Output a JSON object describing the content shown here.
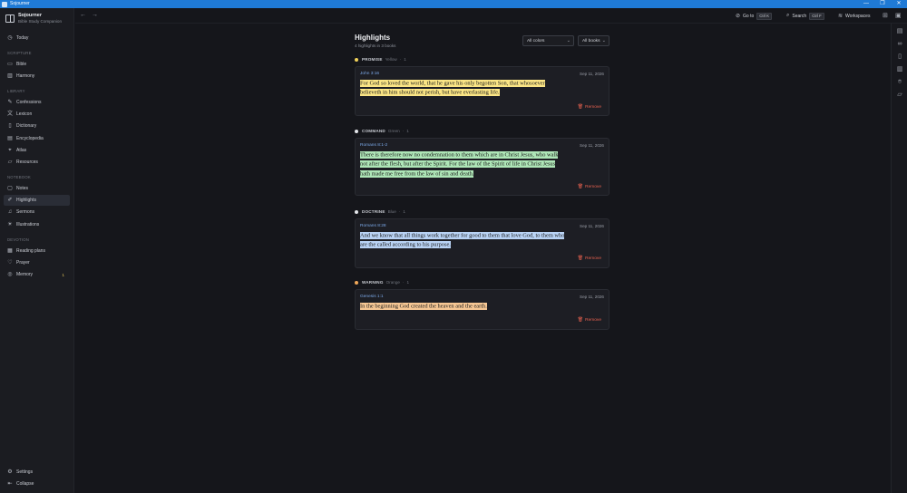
{
  "window": {
    "title": "Sojourner",
    "controls": [
      "—",
      "❐",
      "✕"
    ]
  },
  "brand": {
    "name": "Sojourner",
    "subtitle": "Bible Study Companion"
  },
  "sidebar": {
    "today": "Today",
    "sections": {
      "scripture": "SCRIPTURE",
      "library": "LIBRARY",
      "notebook": "NOTEBOOK",
      "devotion": "DEVOTION"
    },
    "items": {
      "bible": "Bible",
      "harmony": "Harmony",
      "confessions": "Confessions",
      "lexicon": "Lexicon",
      "dictionary": "Dictionary",
      "encyclopedia": "Encyclopedia",
      "atlas": "Atlas",
      "resources": "Resources",
      "notes": "Notes",
      "highlights": "Highlights",
      "sermons": "Sermons",
      "illustrations": "Illustrations",
      "reading_plans": "Reading plans",
      "prayer": "Prayer",
      "memory": "Memory",
      "memory_badge": "1",
      "settings": "Settings",
      "collapse": "Collapse"
    },
    "active": "highlights"
  },
  "topbar": {
    "goto": {
      "label": "Go to",
      "shortcut": "Ctrl K"
    },
    "search": {
      "label": "Search",
      "shortcut": "Ctrl F"
    },
    "workspaces": {
      "label": "Workspaces"
    }
  },
  "page": {
    "title": "Highlights",
    "subtitle": "4 highlights in 3 books",
    "filter_colors": "All colors",
    "filter_books": "All books"
  },
  "groups": [
    {
      "name": "PROMISE",
      "color_name": "Yellow",
      "count": "1",
      "dot": "#f1d25a",
      "highlight": {
        "ref": "John 3:16",
        "date": "Sep 11, 2026",
        "lines": [
          "For God so loved the world, that he gave his only begotten Son, that whosoever",
          "believeth in him should not perish, but have everlasting life."
        ],
        "remove": "Remove"
      }
    },
    {
      "name": "COMMAND",
      "color_name": "Green",
      "count": "1",
      "dot": "#e4e6ea",
      "highlight": {
        "ref": "Romans 8:1-2",
        "date": "Sep 11, 2026",
        "lines": [
          "There is therefore now no condemnation to them which are in Christ Jesus, who walk",
          "not after the flesh, but after the Spirit. For the law of the Spirit of life in Christ Jesus",
          "hath made me free from the law of sin and death."
        ],
        "remove": "Remove"
      }
    },
    {
      "name": "DOCTRINE",
      "color_name": "Blue",
      "count": "1",
      "dot": "#e4e6ea",
      "highlight": {
        "ref": "Romans 8:28",
        "date": "Sep 11, 2026",
        "lines": [
          "And we know that all things work together for good to them that love God, to them who",
          "are the called according to his purpose."
        ],
        "remove": "Remove"
      }
    },
    {
      "name": "WARNING",
      "color_name": "Orange",
      "count": "1",
      "dot": "#f1a85a",
      "highlight": {
        "ref": "Genesis 1:1",
        "date": "Sep 11, 2026",
        "lines": [
          "In the beginning God created the heaven and the earth."
        ],
        "remove": "Remove"
      }
    }
  ],
  "colors": {
    "accent": "#1f7ad6",
    "link": "#7ca9e8",
    "danger": "#e8614f"
  }
}
